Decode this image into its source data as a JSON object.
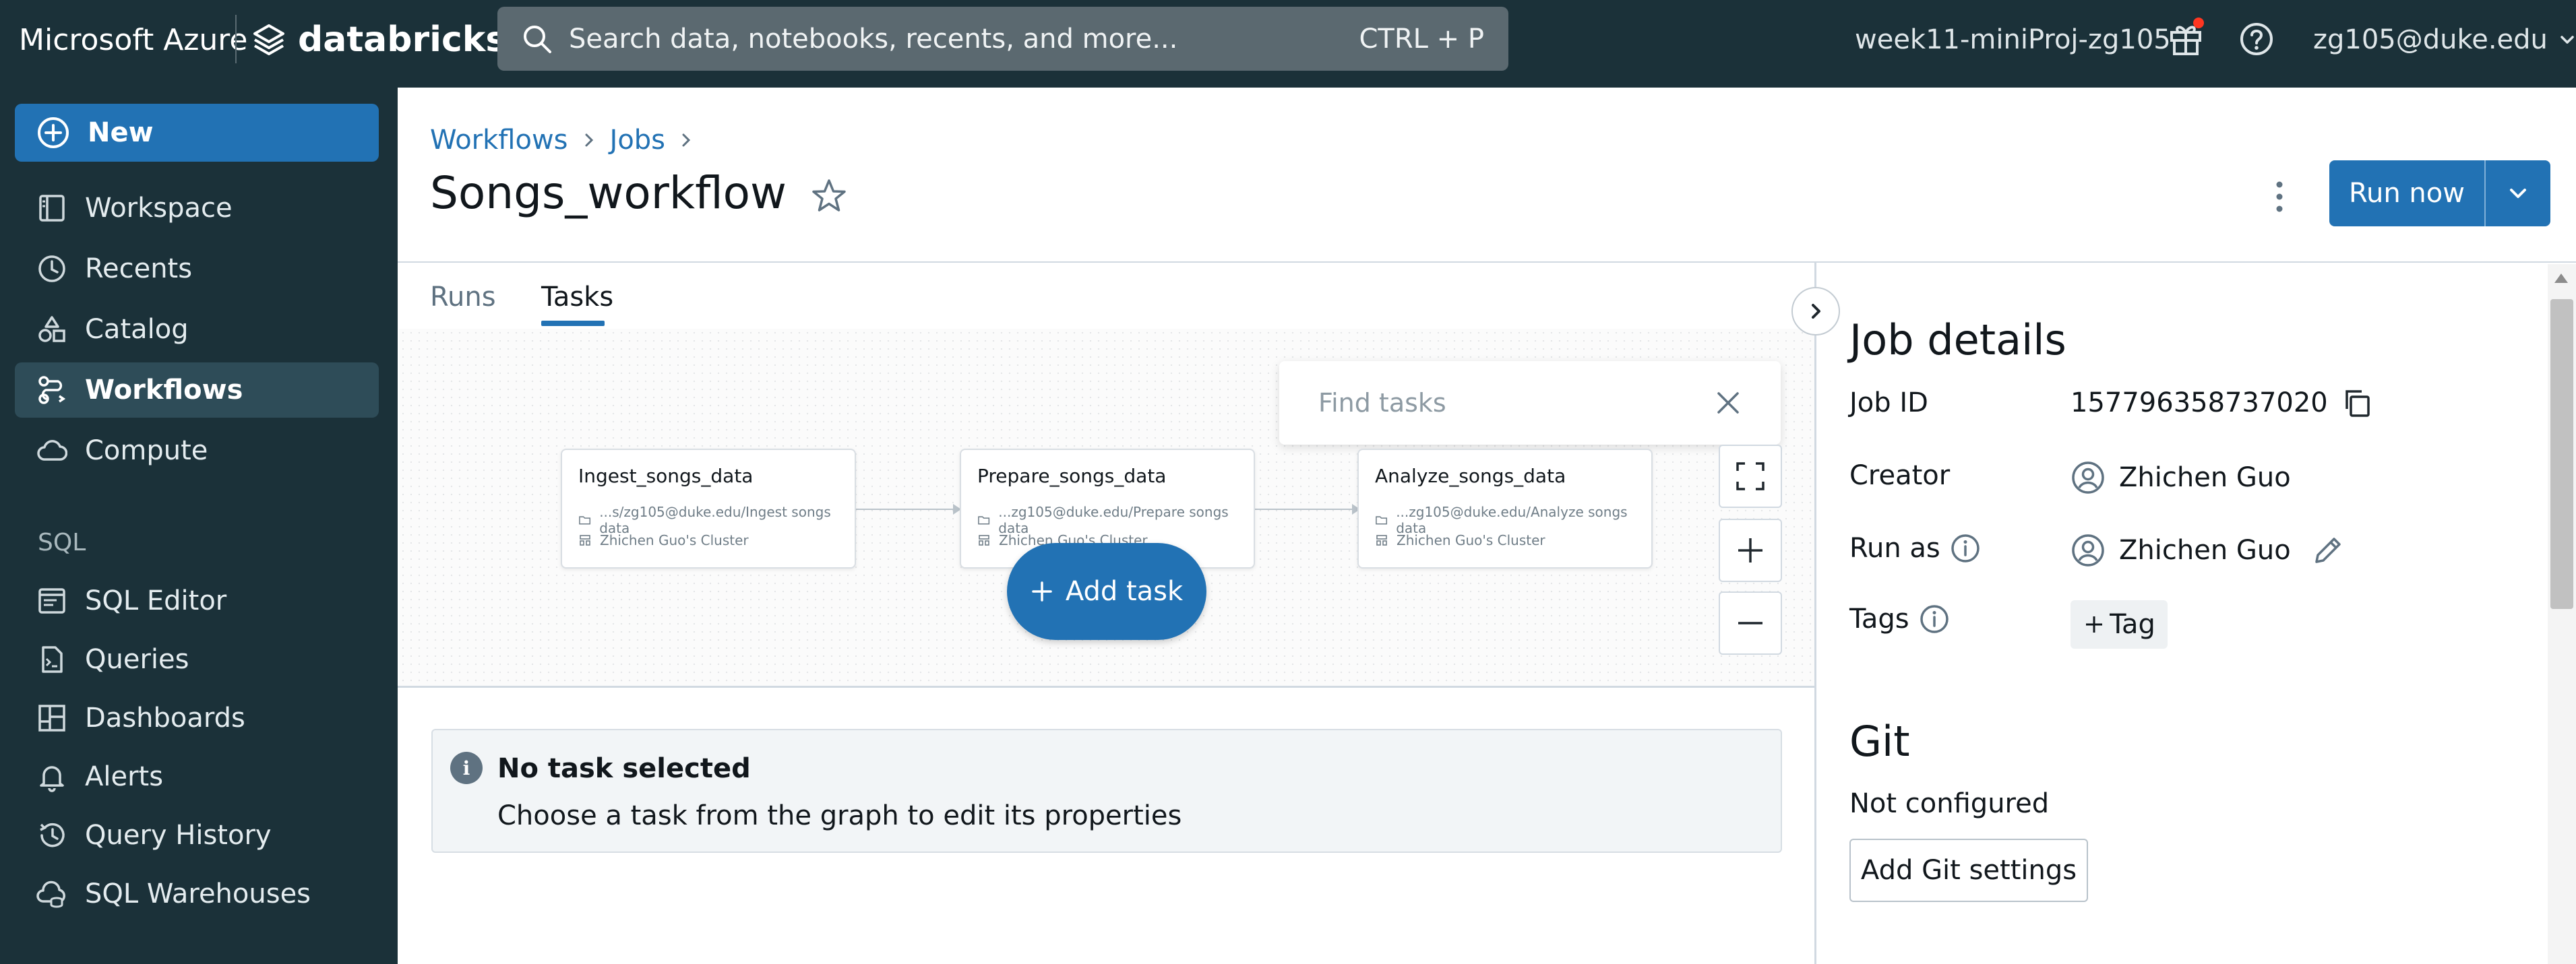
{
  "topbar": {
    "brand_ms": "Microsoft Azure",
    "brand_db": "databricks",
    "search_placeholder": "Search data, notebooks, recents, and more...",
    "search_shortcut": "CTRL + P",
    "workspace": "week11-miniProj-zg105",
    "user": "zg105@duke.edu",
    "notification_color": "#ff3621"
  },
  "sidebar": {
    "new_label": "New",
    "items": [
      {
        "label": "Workspace",
        "icon": "workspace-icon"
      },
      {
        "label": "Recents",
        "icon": "clock-icon"
      },
      {
        "label": "Catalog",
        "icon": "catalog-icon"
      },
      {
        "label": "Workflows",
        "icon": "workflows-icon",
        "active": true
      },
      {
        "label": "Compute",
        "icon": "cloud-icon"
      }
    ],
    "sql_header": "SQL",
    "sql_items": [
      {
        "label": "SQL Editor",
        "icon": "sql-editor-icon"
      },
      {
        "label": "Queries",
        "icon": "queries-icon"
      },
      {
        "label": "Dashboards",
        "icon": "dashboards-icon"
      },
      {
        "label": "Alerts",
        "icon": "bell-icon"
      },
      {
        "label": "Query History",
        "icon": "history-icon"
      },
      {
        "label": "SQL Warehouses",
        "icon": "warehouse-icon"
      }
    ]
  },
  "header": {
    "breadcrumb": [
      "Workflows",
      "Jobs"
    ],
    "title": "Songs_workflow",
    "run_now": "Run now",
    "accent": "#2272b4"
  },
  "tabs": [
    {
      "label": "Runs",
      "active": false
    },
    {
      "label": "Tasks",
      "active": true
    }
  ],
  "graph": {
    "find_placeholder": "Find tasks",
    "add_task": "Add task",
    "tasks": [
      {
        "name": "Ingest_songs_data",
        "path": "...s/zg105@duke.edu/Ingest songs data",
        "cluster": "Zhichen Guo's Cluster"
      },
      {
        "name": "Prepare_songs_data",
        "path": "...zg105@duke.edu/Prepare songs data",
        "cluster": "Zhichen Guo's Cluster"
      },
      {
        "name": "Analyze_songs_data",
        "path": "...zg105@duke.edu/Analyze songs data",
        "cluster": "Zhichen Guo's Cluster"
      }
    ]
  },
  "notice": {
    "title": "No task selected",
    "body": "Choose a task from the graph to edit its properties"
  },
  "job_details": {
    "title": "Job details",
    "job_id_label": "Job ID",
    "job_id": "157796358737020",
    "creator_label": "Creator",
    "creator": "Zhichen Guo",
    "run_as_label": "Run as",
    "run_as": "Zhichen Guo",
    "tags_label": "Tags",
    "tag_button": "Tag"
  },
  "git": {
    "title": "Git",
    "status": "Not configured",
    "button": "Add Git settings"
  }
}
